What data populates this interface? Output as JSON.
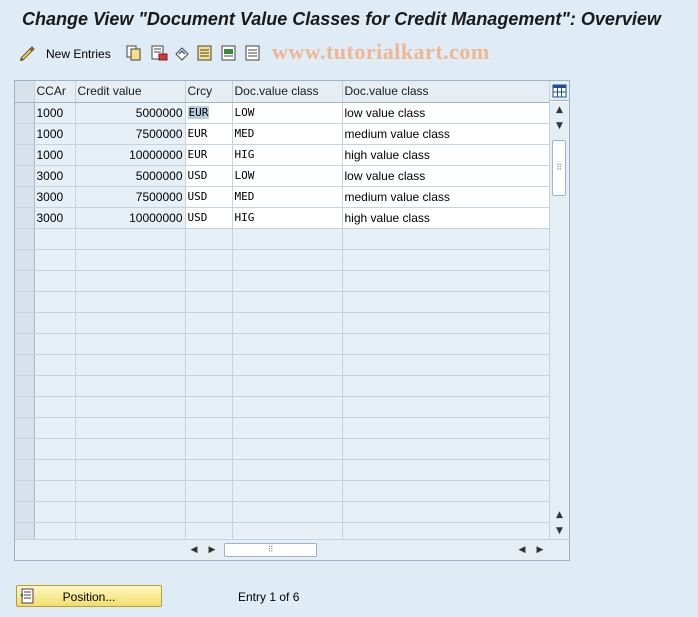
{
  "title": "Change View \"Document Value Classes for Credit Management\": Overview",
  "toolbar": {
    "new_entries_label": "New Entries",
    "icons": [
      "edit-pencil-icon",
      "copy-icon",
      "delete-icon",
      "undo-icon",
      "select-all-icon",
      "select-block-icon",
      "deselect-all-icon"
    ]
  },
  "watermark": "www.tutorialkart.com",
  "table": {
    "columns": [
      "CCAr",
      "Credit value",
      "Crcy",
      "Doc.value class",
      "Doc.value class"
    ],
    "rows": [
      {
        "ccar": "1000",
        "credit_value": "5000000",
        "crcy": "EUR",
        "doc_class": "LOW",
        "doc_class_text": "low value class"
      },
      {
        "ccar": "1000",
        "credit_value": "7500000",
        "crcy": "EUR",
        "doc_class": "MED",
        "doc_class_text": "medium value class"
      },
      {
        "ccar": "1000",
        "credit_value": "10000000",
        "crcy": "EUR",
        "doc_class": "HIG",
        "doc_class_text": "high value class"
      },
      {
        "ccar": "3000",
        "credit_value": "5000000",
        "crcy": "USD",
        "doc_class": "LOW",
        "doc_class_text": "low value class"
      },
      {
        "ccar": "3000",
        "credit_value": "7500000",
        "crcy": "USD",
        "doc_class": "MED",
        "doc_class_text": "medium value class"
      },
      {
        "ccar": "3000",
        "credit_value": "10000000",
        "crcy": "USD",
        "doc_class": "HIG",
        "doc_class_text": "high value class"
      }
    ],
    "empty_row_count": 15
  },
  "scroll": {
    "up_arrow": "▲",
    "down_arrow": "▼",
    "left_arrow": "◀",
    "right_arrow": "▶",
    "grip": "⠿"
  },
  "position_button_label": "Position...",
  "entry_info": "Entry 1 of 6",
  "colors": {
    "background": "#dfebf5",
    "grid_border": "#9fb3c6",
    "button_yellow": "#f3de6b",
    "watermark": "#f0b48a"
  }
}
